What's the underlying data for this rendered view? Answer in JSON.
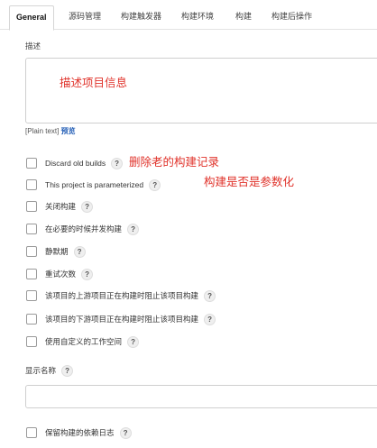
{
  "tabs": [
    {
      "label": "General",
      "active": true
    },
    {
      "label": "源码管理",
      "active": false
    },
    {
      "label": "构建触发器",
      "active": false
    },
    {
      "label": "构建环境",
      "active": false
    },
    {
      "label": "构建",
      "active": false
    },
    {
      "label": "构建后操作",
      "active": false
    }
  ],
  "description": {
    "label": "描述",
    "note": "描述项目信息",
    "format_text": "[Plain text]",
    "preview_label": "预览"
  },
  "help_glyph": "?",
  "options": [
    {
      "label": "Discard old builds",
      "checked": false
    },
    {
      "label": "This project is parameterized",
      "checked": false
    },
    {
      "label": "关闭构建",
      "checked": false
    },
    {
      "label": "在必要的时候并发构建",
      "checked": false
    },
    {
      "label": "静默期",
      "checked": false
    },
    {
      "label": "重试次数",
      "checked": false
    },
    {
      "label": "该项目的上游项目正在构建时阻止该项目构建",
      "checked": false
    },
    {
      "label": "该项目的下游项目正在构建时阻止该项目构建",
      "checked": false
    },
    {
      "label": "使用自定义的工作空间",
      "checked": false
    }
  ],
  "annotations": {
    "discard_old_builds": "删除老的构建记录",
    "parameterized": "构建是否是参数化"
  },
  "display_name": {
    "label": "显示名称",
    "value": ""
  },
  "keep_dependencies": {
    "label": "保留构建的依赖日志",
    "checked": false
  },
  "colors": {
    "annotation_red": "#e0322a",
    "link_blue": "#2a63b8",
    "border": "#cfcfcf"
  }
}
